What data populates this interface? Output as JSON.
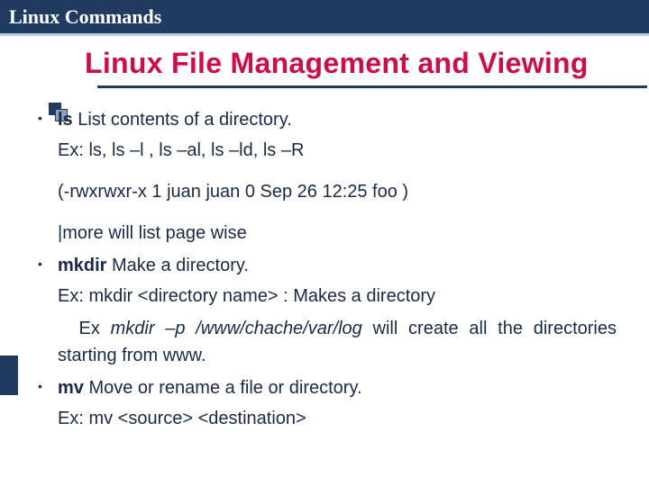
{
  "header": {
    "title": "Linux Commands"
  },
  "title": "Linux File Management and Viewing",
  "items": [
    {
      "cmd": "ls",
      "desc": " List contents of a directory.",
      "lines": [
        "Ex: ls, ls –l , ls –al, ls –ld, ls –R",
        "(-rwxrwxr-x 1 juan juan 0 Sep 26 12:25 foo )",
        "|more will list page wise"
      ]
    },
    {
      "cmd": "mkdir",
      "desc": " Make a directory.",
      "ex1": "Ex: mkdir <directory name> : Makes a directory",
      "ex2_pre": "Ex ",
      "ex2_it": "mkdir –p /www/chache/var/log",
      "ex2_post": " will create all the directories starting from www."
    },
    {
      "cmd": "mv",
      "desc": " Move or rename a file or directory.",
      "lines": [
        "Ex: mv <source> <destination>"
      ]
    }
  ]
}
